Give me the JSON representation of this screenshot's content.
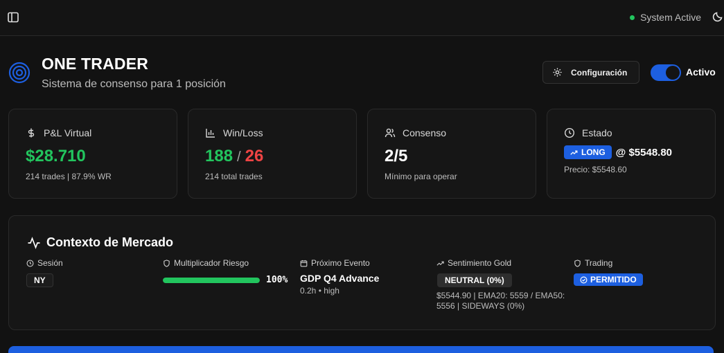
{
  "topbar": {
    "status_text": "System Active",
    "status_color": "#22c55e"
  },
  "header": {
    "title": "ONE TRADER",
    "subtitle": "Sistema de consenso para 1 posición",
    "config_label": "Configuración",
    "toggle_label": "Activo",
    "toggle_on": true
  },
  "cards": {
    "pnl": {
      "label": "P&L Virtual",
      "value": "$28.710",
      "sub": "214 trades | 87.9% WR"
    },
    "winloss": {
      "label": "Win/Loss",
      "wins": "188",
      "separator": "/",
      "losses": "26",
      "sub": "214 total trades"
    },
    "consenso": {
      "label": "Consenso",
      "value": "2/5",
      "sub": "Mínimo para operar"
    },
    "estado": {
      "label": "Estado",
      "badge": "LONG",
      "price": "@ $5548.80",
      "sub": "Precio: $5548.60"
    }
  },
  "market": {
    "title": "Contexto de Mercado",
    "session": {
      "label": "Sesión",
      "value": "NY"
    },
    "risk": {
      "label": "Multiplicador Riesgo",
      "percent_text": "100%",
      "percent": 100
    },
    "event": {
      "label": "Próximo Evento",
      "name": "GDP Q4 Advance",
      "sub": "0.2h • high"
    },
    "sentiment": {
      "label": "Sentimiento Gold",
      "badge": "NEUTRAL (0%)",
      "detail": "$5544.90 | EMA20: 5559 / EMA50: 5556 | SIDEWAYS (0%)"
    },
    "trading": {
      "label": "Trading",
      "badge": "PERMITIDO"
    }
  },
  "colors": {
    "accent": "#1d5fe0",
    "positive": "#22c55e",
    "negative": "#ef4444",
    "background": "#121212"
  }
}
